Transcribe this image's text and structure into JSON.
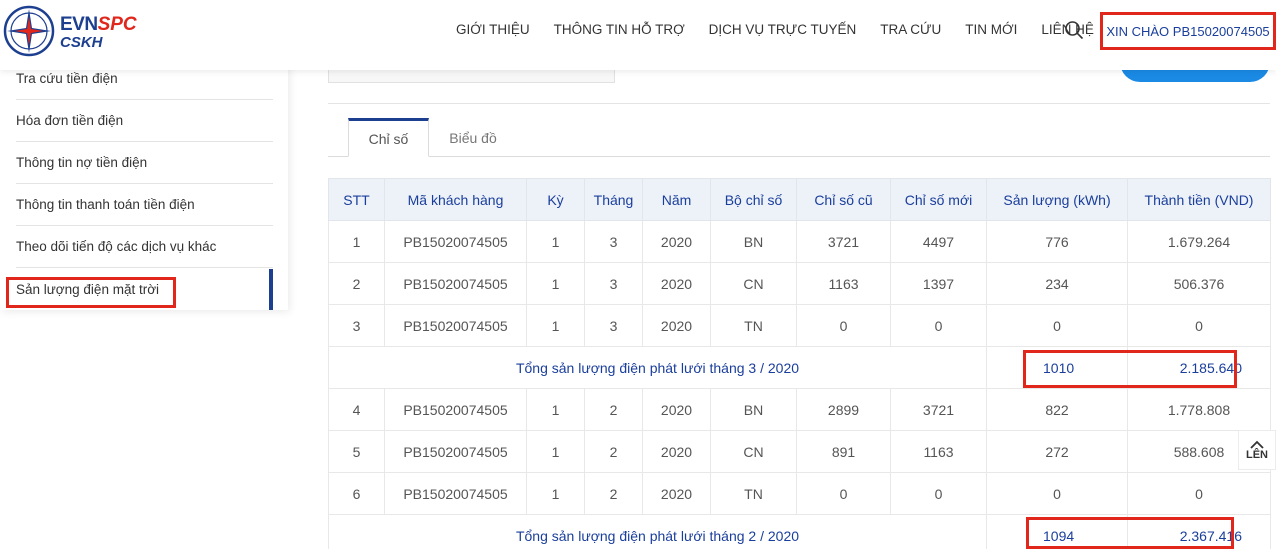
{
  "header": {
    "logo": {
      "brand_evn": "EVN",
      "brand_spc": "SPC",
      "sub": "CSKH"
    },
    "nav": [
      "GIỚI THIỆU",
      "THÔNG TIN HỖ TRỢ",
      "DỊCH VỤ TRỰC TUYẾN",
      "TRA CỨU",
      "TIN MỚI",
      "LIÊN HỆ"
    ],
    "greeting": "XIN CHÀO PB15020074505",
    "search_icon": "search-icon"
  },
  "sidebar": {
    "items": [
      "Tra cứu tiền điện",
      "Hóa đơn tiền điện",
      "Thông tin nợ tiền điện",
      "Thông tin thanh toán tiền điện",
      "Theo dõi tiến độ các dịch vụ khác",
      "Sản lượng điện mặt trời"
    ],
    "active_index": 5
  },
  "tabs": {
    "active": "Chỉ số",
    "inactive": "Biểu đồ"
  },
  "table": {
    "headers": [
      "STT",
      "Mã khách hàng",
      "Kỳ",
      "Tháng",
      "Năm",
      "Bộ chỉ số",
      "Chỉ số cũ",
      "Chỉ số mới",
      "Sản lượng (kWh)",
      "Thành tiền (VND)"
    ],
    "group1": {
      "rows": [
        [
          "1",
          "PB15020074505",
          "1",
          "3",
          "2020",
          "BN",
          "3721",
          "4497",
          "776",
          "1.679.264"
        ],
        [
          "2",
          "PB15020074505",
          "1",
          "3",
          "2020",
          "CN",
          "1163",
          "1397",
          "234",
          "506.376"
        ],
        [
          "3",
          "PB15020074505",
          "1",
          "3",
          "2020",
          "TN",
          "0",
          "0",
          "0",
          "0"
        ]
      ],
      "total_label": "Tổng sản lượng điện phát lưới tháng 3 / 2020",
      "total_kwh": "1010",
      "total_vnd": "2.185.640"
    },
    "group2": {
      "rows": [
        [
          "4",
          "PB15020074505",
          "1",
          "2",
          "2020",
          "BN",
          "2899",
          "3721",
          "822",
          "1.778.808"
        ],
        [
          "5",
          "PB15020074505",
          "1",
          "2",
          "2020",
          "CN",
          "891",
          "1163",
          "272",
          "588.608"
        ],
        [
          "6",
          "PB15020074505",
          "1",
          "2",
          "2020",
          "TN",
          "0",
          "0",
          "0",
          "0"
        ]
      ],
      "total_label": "Tổng sản lượng điện phát lưới tháng 2 / 2020",
      "total_kwh": "1094",
      "total_vnd": "2.367.416"
    }
  },
  "back_to_top": "LÊN",
  "colors": {
    "brand_blue": "#1d3f8f",
    "brand_red": "#e1261c",
    "header_bg": "#edf2f8",
    "accent_blue": "#1a8ae5"
  }
}
